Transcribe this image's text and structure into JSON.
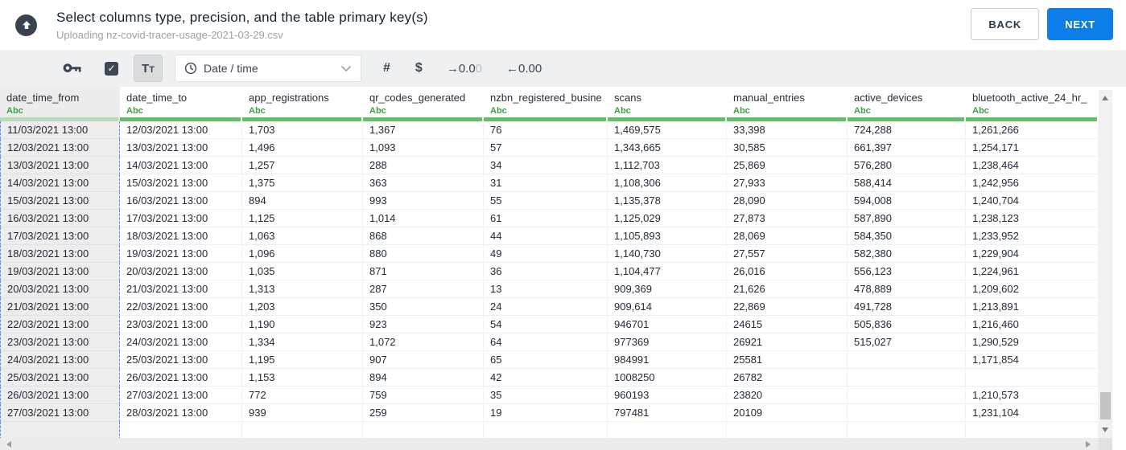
{
  "header": {
    "title": "Select columns type, precision, and the table primary key(s)",
    "subtitle": "Uploading nz-covid-tracer-usage-2021-03-29.csv",
    "back_label": "BACK",
    "next_label": "NEXT"
  },
  "toolbar": {
    "check_glyph": "✓",
    "checkbox_checked": true,
    "text_type_label": "Tt",
    "type_select": {
      "value": "Date / time"
    },
    "number_glyph": "#",
    "currency_glyph": "$",
    "increase_decimal": {
      "main": "→0.0",
      "faded": "0"
    },
    "decrease_decimal": {
      "main": "←0.00"
    }
  },
  "colors": {
    "accent_blue": "#0d7de9",
    "header_green": "#68bd6b",
    "selected_column_green": "#b7dbb9",
    "selection_dash_blue": "#4f8af8",
    "dark_slate": "#3d4655"
  },
  "table": {
    "type_label": "Abc",
    "columns": [
      {
        "name": "date_time_from",
        "selected": true
      },
      {
        "name": "date_time_to",
        "selected": false
      },
      {
        "name": "app_registrations",
        "selected": false
      },
      {
        "name": "qr_codes_generated",
        "selected": false
      },
      {
        "name": "nzbn_registered_busine",
        "selected": false
      },
      {
        "name": "scans",
        "selected": false
      },
      {
        "name": "manual_entries",
        "selected": false
      },
      {
        "name": "active_devices",
        "selected": false
      },
      {
        "name": "bluetooth_active_24_hr_",
        "selected": false
      }
    ],
    "rows": [
      [
        "11/03/2021 13:00",
        "12/03/2021 13:00",
        "1,703",
        "1,367",
        "76",
        "1,469,575",
        "33,398",
        "724,288",
        "1,261,266"
      ],
      [
        "12/03/2021 13:00",
        "13/03/2021 13:00",
        "1,496",
        "1,093",
        "57",
        "1,343,665",
        "30,585",
        "661,397",
        "1,254,171"
      ],
      [
        "13/03/2021 13:00",
        "14/03/2021 13:00",
        "1,257",
        "288",
        "34",
        "1,112,703",
        "25,869",
        "576,280",
        "1,238,464"
      ],
      [
        "14/03/2021 13:00",
        "15/03/2021 13:00",
        "1,375",
        "363",
        "31",
        "1,108,306",
        "27,933",
        "588,414",
        "1,242,956"
      ],
      [
        "15/03/2021 13:00",
        "16/03/2021 13:00",
        "894",
        "993",
        "55",
        "1,135,378",
        "28,090",
        "594,008",
        "1,240,704"
      ],
      [
        "16/03/2021 13:00",
        "17/03/2021 13:00",
        "1,125",
        "1,014",
        "61",
        "1,125,029",
        "27,873",
        "587,890",
        "1,238,123"
      ],
      [
        "17/03/2021 13:00",
        "18/03/2021 13:00",
        "1,063",
        "868",
        "44",
        "1,105,893",
        "28,069",
        "584,350",
        "1,233,952"
      ],
      [
        "18/03/2021 13:00",
        "19/03/2021 13:00",
        "1,096",
        "880",
        "49",
        "1,140,730",
        "27,557",
        "582,380",
        "1,229,904"
      ],
      [
        "19/03/2021 13:00",
        "20/03/2021 13:00",
        "1,035",
        "871",
        "36",
        "1,104,477",
        "26,016",
        "556,123",
        "1,224,961"
      ],
      [
        "20/03/2021 13:00",
        "21/03/2021 13:00",
        "1,313",
        "287",
        "13",
        "909,369",
        "21,626",
        "478,889",
        "1,209,602"
      ],
      [
        "21/03/2021 13:00",
        "22/03/2021 13:00",
        "1,203",
        "350",
        "24",
        "909,614",
        "22,869",
        "491,728",
        "1,213,891"
      ],
      [
        "22/03/2021 13:00",
        "23/03/2021 13:00",
        "1,190",
        "923",
        "54",
        "946701",
        "24615",
        "505,836",
        "1,216,460"
      ],
      [
        "23/03/2021 13:00",
        "24/03/2021 13:00",
        "1,334",
        "1,072",
        "64",
        "977369",
        "26921",
        "515,027",
        "1,290,529"
      ],
      [
        "24/03/2021 13:00",
        "25/03/2021 13:00",
        "1,195",
        "907",
        "65",
        "984991",
        "25581",
        "",
        "1,171,854"
      ],
      [
        "25/03/2021 13:00",
        "26/03/2021 13:00",
        "1,153",
        "894",
        "42",
        "1008250",
        "26782",
        "",
        ""
      ],
      [
        "26/03/2021 13:00",
        "27/03/2021 13:00",
        "772",
        "759",
        "35",
        "960193",
        "23820",
        "",
        "1,210,573"
      ],
      [
        "27/03/2021 13:00",
        "28/03/2021 13:00",
        "939",
        "259",
        "19",
        "797481",
        "20109",
        "",
        "1,231,104"
      ]
    ]
  }
}
